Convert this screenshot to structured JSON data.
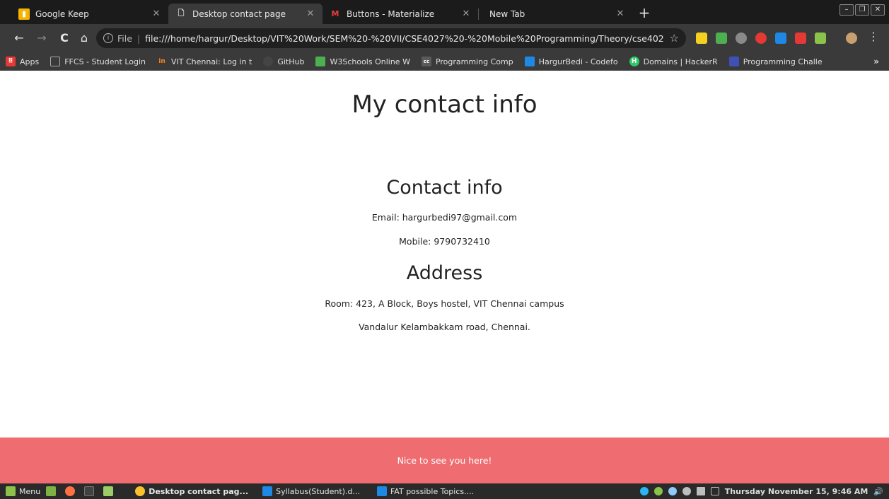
{
  "browser": {
    "tabs": [
      {
        "title": "Google Keep",
        "active": false,
        "favicon_color": "#f5b400"
      },
      {
        "title": "Desktop contact page",
        "active": true,
        "favicon_color": "#cccccc"
      },
      {
        "title": "Buttons - Materialize",
        "active": false,
        "favicon_color": "#ee3c3c"
      },
      {
        "title": "New Tab",
        "active": false
      }
    ],
    "new_tab_glyph": "+",
    "window_buttons": [
      "–",
      "❐",
      "✕"
    ],
    "address": {
      "scheme_label": "File",
      "url": "file:///home/hargur/Desktop/VIT%20Work/SEM%20-%20VII/CSE4027%20-%20Mobile%20Programming/Theory/cse402..."
    },
    "bookmarks": [
      {
        "label": "Apps",
        "icon": "apps-grid-icon",
        "color": "#e53935"
      },
      {
        "label": "FFCS - Student Login",
        "icon": "page-icon",
        "color": "#777777"
      },
      {
        "label": "VIT Chennai: Log in t",
        "icon": "vit-icon",
        "color": "#f58220"
      },
      {
        "label": "GitHub",
        "icon": "github-icon",
        "color": "#444444"
      },
      {
        "label": "W3Schools Online W",
        "icon": "w3schools-icon",
        "color": "#4caf50"
      },
      {
        "label": "Programming Comp",
        "icon": "cc-icon",
        "color": "#5a5a5a"
      },
      {
        "label": "HargurBedi - Codefo",
        "icon": "codeforces-icon",
        "color": "#1e88e5"
      },
      {
        "label": "Domains | HackerR",
        "icon": "hackerrank-icon",
        "color": "#2ec866"
      },
      {
        "label": "Programming Challe",
        "icon": "challenge-icon",
        "color": "#3f51b5"
      }
    ],
    "bookmarks_more": "»"
  },
  "page": {
    "title": "My contact info",
    "contact": {
      "heading": "Contact info",
      "email": "Email: hargurbedi97@gmail.com",
      "mobile": "Mobile: 9790732410"
    },
    "address": {
      "heading": "Address",
      "line1": "Room: 423, A Block, Boys hostel, VIT Chennai campus",
      "line2": "Vandalur Kelambakkam road, Chennai."
    },
    "footer_text": "Nice to see you here!",
    "footer_color": "#ef6d71"
  },
  "taskbar": {
    "menu_label": "Menu",
    "windows": [
      {
        "label": "Desktop contact pag...",
        "active": true
      },
      {
        "label": "Syllabus(Student).d...",
        "active": false
      },
      {
        "label": "FAT possible Topics....",
        "active": false
      }
    ],
    "clock": "Thursday November 15,  9:46 AM"
  }
}
